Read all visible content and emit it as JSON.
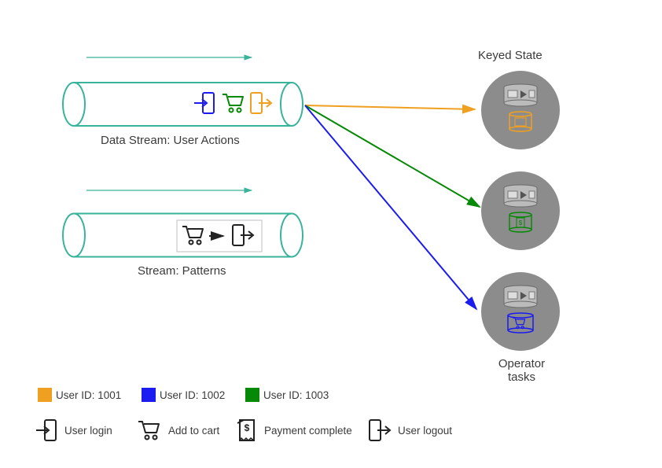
{
  "header": {
    "keyed_state": "Keyed State"
  },
  "streams": {
    "user_actions": {
      "label": "Data Stream: User Actions"
    },
    "patterns": {
      "label": "Stream: Patterns"
    }
  },
  "operator_tasks": {
    "label": "Operator\ntasks"
  },
  "legend": {
    "users": [
      {
        "label": "User ID: 1001",
        "color": "#f0a020"
      },
      {
        "label": "User ID: 1002",
        "color": "#1b1bf2"
      },
      {
        "label": "User ID: 1003",
        "color": "#068906"
      }
    ],
    "icons": [
      {
        "name": "login-icon",
        "label": "User login"
      },
      {
        "name": "cart-icon",
        "label": "Add to cart"
      },
      {
        "name": "receipt-icon",
        "label": "Payment complete"
      },
      {
        "name": "logout-icon",
        "label": "User logout"
      }
    ]
  },
  "colors": {
    "teal": "#39b39a",
    "orange": "#f0a020",
    "blue": "#1b1bf2",
    "green": "#068906",
    "gray": "#8c8c8c",
    "darkgray": "#6a6a6a"
  }
}
